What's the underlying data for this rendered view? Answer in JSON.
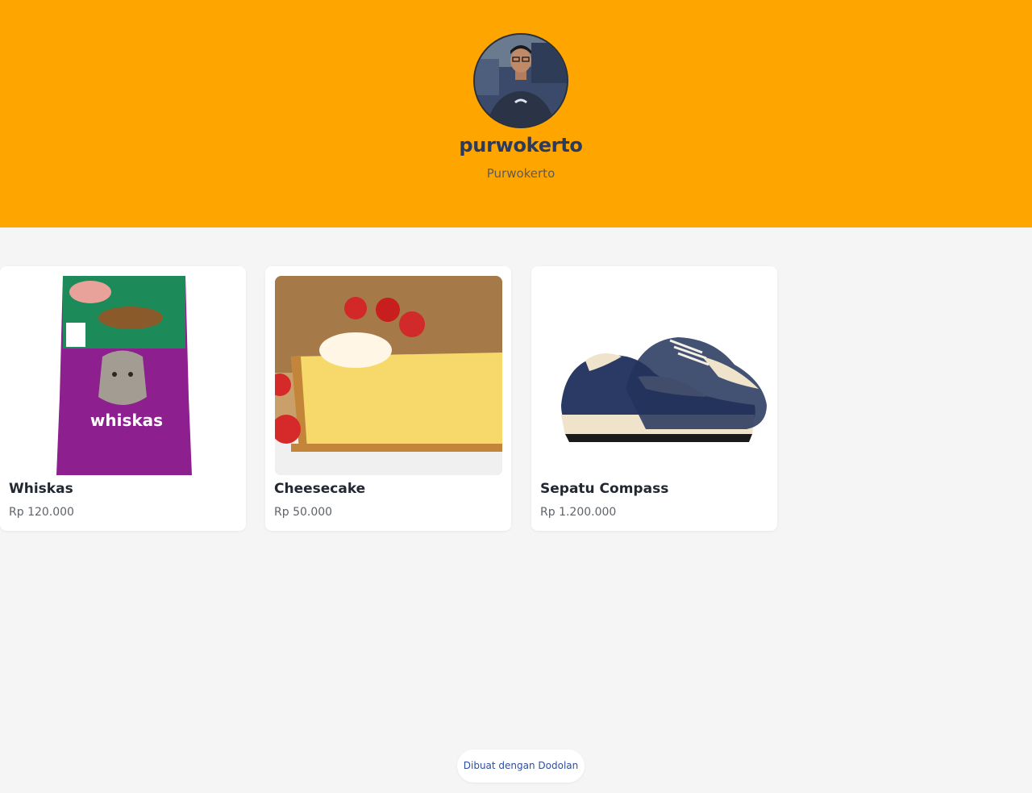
{
  "store": {
    "name": "purwokerto",
    "city": "Purwokerto"
  },
  "products": [
    {
      "name": "Whiskas",
      "price": "Rp 120.000",
      "image_label": "whiskas"
    },
    {
      "name": "Cheesecake",
      "price": "Rp 50.000"
    },
    {
      "name": "Sepatu Compass",
      "price": "Rp 1.200.000"
    }
  ],
  "footer": {
    "label": "Dibuat dengan Dodolan"
  },
  "colors": {
    "header": "#ffa500",
    "background": "#f5f5f5",
    "store_name": "#2c3a5c",
    "link": "#2e4f9e"
  }
}
